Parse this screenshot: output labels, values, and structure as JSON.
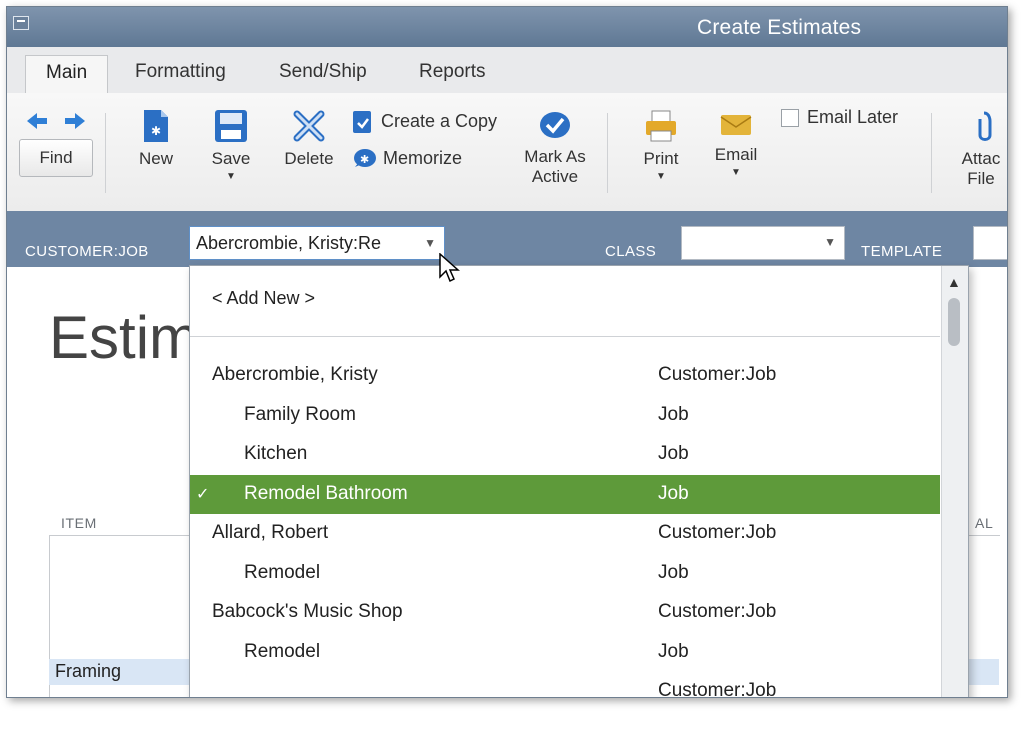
{
  "window": {
    "title": "Create Estimates"
  },
  "tabs": [
    {
      "label": "Main",
      "active": true
    },
    {
      "label": "Formatting",
      "active": false
    },
    {
      "label": "Send/Ship",
      "active": false
    },
    {
      "label": "Reports",
      "active": false
    }
  ],
  "ribbon": {
    "find": "Find",
    "new": "New",
    "save": "Save",
    "delete": "Delete",
    "create_copy": "Create a Copy",
    "memorize": "Memorize",
    "mark_as_active_line1": "Mark As",
    "mark_as_active_line2": "Active",
    "print": "Print",
    "email": "Email",
    "email_later": "Email Later",
    "attach_line1": "Attac",
    "attach_line2": "File"
  },
  "customer_bar": {
    "customer_job_label": "CUSTOMER:JOB",
    "customer_job_value": "Abercrombie, Kristy:Re",
    "class_label": "CLASS",
    "class_value": "",
    "template_label": "TEMPLATE"
  },
  "form": {
    "title": "Estim",
    "item_header": "ITEM",
    "total_header": "AL",
    "first_item": "Framing"
  },
  "dropdown": {
    "add_new": "< Add New >",
    "items": [
      {
        "name": "Abercrombie, Kristy",
        "type": "Customer:Job",
        "indent": false,
        "selected": false
      },
      {
        "name": "Family Room",
        "type": "Job",
        "indent": true,
        "selected": false
      },
      {
        "name": "Kitchen",
        "type": "Job",
        "indent": true,
        "selected": false
      },
      {
        "name": "Remodel Bathroom",
        "type": "Job",
        "indent": true,
        "selected": true
      },
      {
        "name": "Allard, Robert",
        "type": "Customer:Job",
        "indent": false,
        "selected": false
      },
      {
        "name": "Remodel",
        "type": "Job",
        "indent": true,
        "selected": false
      },
      {
        "name": "Babcock's Music Shop",
        "type": "Customer:Job",
        "indent": false,
        "selected": false
      },
      {
        "name": "Remodel",
        "type": "Job",
        "indent": true,
        "selected": false
      },
      {
        "name": "",
        "type": "Customer:Job",
        "indent": false,
        "selected": false
      }
    ],
    "selected_marker": "✓"
  },
  "colors": {
    "titlebar": "#6b829e",
    "customer_bar": "#6e86a3",
    "selection": "#5e9a3a"
  }
}
